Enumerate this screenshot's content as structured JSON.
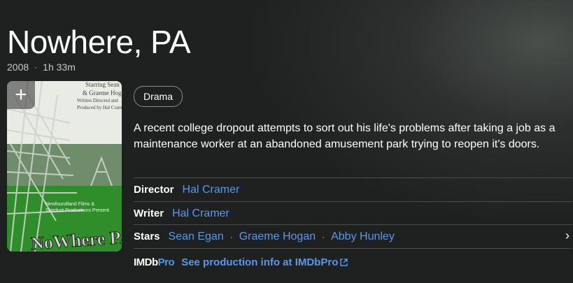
{
  "title": "Nowhere, PA",
  "meta": {
    "year": "2008",
    "separator": "·",
    "runtime": "1h 33m"
  },
  "poster": {
    "add_label": "+",
    "text_lines": [
      "Starring Sean Egan",
      "& Graeme Hogan",
      "Written Directed and",
      "Produced by Hal Cramer"
    ],
    "studio_lines": [
      "Newfoundland Films &",
      "Stardust Productions Present"
    ],
    "big_title": "NoWhere PA"
  },
  "genres": [
    "Drama"
  ],
  "plot": "A recent college dropout attempts to sort out his life's problems after taking a job as a maintenance worker at an abandoned amusement park trying to reopen it's doors.",
  "credits": {
    "director": {
      "label": "Director",
      "names": [
        "Hal Cramer"
      ]
    },
    "writer": {
      "label": "Writer",
      "names": [
        "Hal Cramer"
      ]
    },
    "stars": {
      "label": "Stars",
      "names": [
        "Sean Egan",
        "Graeme Hogan",
        "Abby Hunley"
      ],
      "sep": "·",
      "chevron": "›"
    }
  },
  "imdbpro": {
    "logo_a": "IMDb",
    "logo_b": "Pro",
    "link": "See production info at IMDbPro",
    "ext_icon": "external-link-icon"
  }
}
